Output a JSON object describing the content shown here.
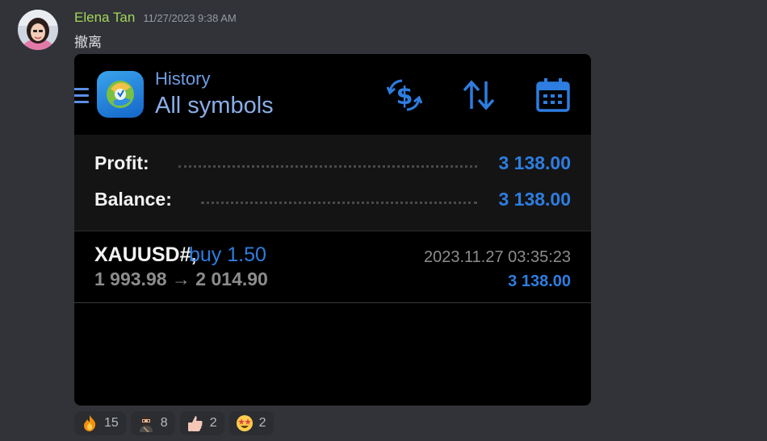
{
  "message": {
    "author": "Elena Tan",
    "timestamp": "11/27/2023 9:38 AM",
    "text": "撤离"
  },
  "screenshot": {
    "header": {
      "title": "History",
      "subtitle": "All symbols"
    },
    "summary": {
      "profit_label": "Profit:",
      "profit_value": "3 138.00",
      "balance_label": "Balance:",
      "balance_value": "3 138.00"
    },
    "deal": {
      "symbol": "XAUUSD#,",
      "type": "buy 1.50",
      "prices": "1 993.98 → 2 014.90",
      "time": "2023.11.27 03:35:23",
      "profit": "3 138.00"
    }
  },
  "reactions": [
    {
      "emoji": "fire-emoji",
      "count": "15"
    },
    {
      "emoji": "ninja-emoji",
      "count": "8"
    },
    {
      "emoji": "thumbs-up-emoji",
      "count": "2"
    },
    {
      "emoji": "star-struck-emoji",
      "count": "2"
    }
  ],
  "colors": {
    "author": "#a3d65b",
    "accent_blue": "#2e7de0",
    "discord_bg": "#313338"
  }
}
